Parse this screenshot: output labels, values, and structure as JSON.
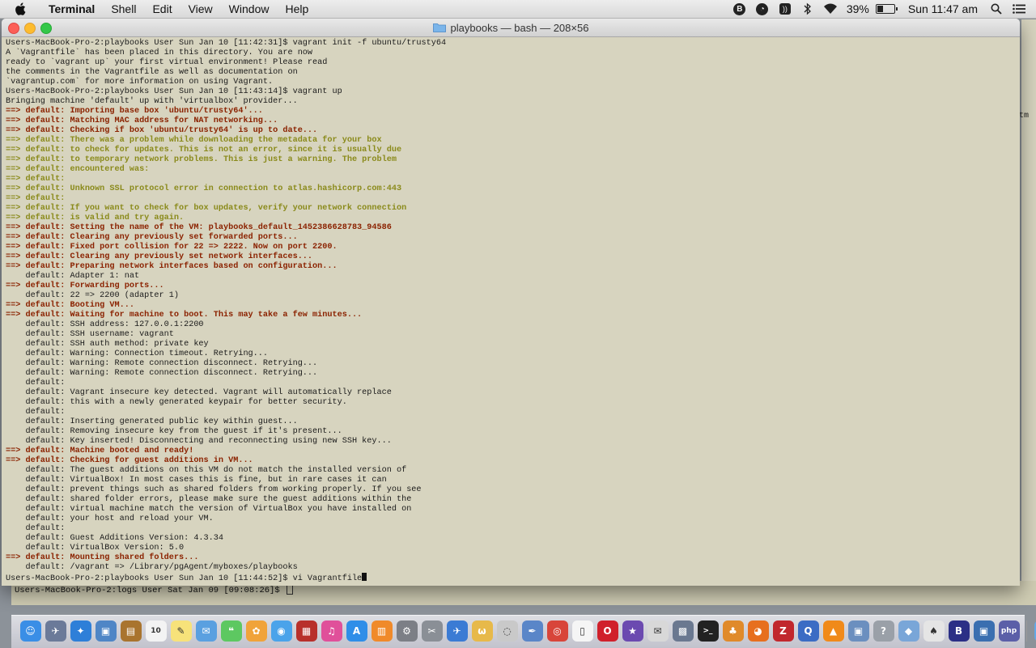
{
  "menubar": {
    "app_name": "Terminal",
    "menus": [
      "Shell",
      "Edit",
      "View",
      "Window",
      "Help"
    ],
    "battery": "39%",
    "clock": "Sun 11:47 am"
  },
  "window": {
    "title": "playbooks — bash — 208×56"
  },
  "terminal": {
    "lines": [
      {
        "text": "Users-MacBook-Pro-2:playbooks User Sun Jan 10 [11:42:31]$ vagrant init -f ubuntu/trusty64",
        "style": "plain"
      },
      {
        "text": "A `Vagrantfile` has been placed in this directory. You are now",
        "style": "plain"
      },
      {
        "text": "ready to `vagrant up` your first virtual environment! Please read",
        "style": "plain"
      },
      {
        "text": "the comments in the Vagrantfile as well as documentation on",
        "style": "plain"
      },
      {
        "text": "`vagrantup.com` for more information on using Vagrant.",
        "style": "plain"
      },
      {
        "text": "Users-MacBook-Pro-2:playbooks User Sun Jan 10 [11:43:14]$ vagrant up",
        "style": "plain"
      },
      {
        "text": "Bringing machine 'default' up with 'virtualbox' provider...",
        "style": "plain"
      },
      {
        "text": "==> default: Importing base box 'ubuntu/trusty64'...",
        "style": "warn"
      },
      {
        "text": "==> default: Matching MAC address for NAT networking...",
        "style": "warn"
      },
      {
        "text": "==> default: Checking if box 'ubuntu/trusty64' is up to date...",
        "style": "warn"
      },
      {
        "text": "==> default: There was a problem while downloading the metadata for your box",
        "style": "note"
      },
      {
        "text": "==> default: to check for updates. This is not an error, since it is usually due",
        "style": "note"
      },
      {
        "text": "==> default: to temporary network problems. This is just a warning. The problem",
        "style": "note"
      },
      {
        "text": "==> default: encountered was:",
        "style": "note"
      },
      {
        "text": "==> default:",
        "style": "note"
      },
      {
        "text": "==> default: Unknown SSL protocol error in connection to atlas.hashicorp.com:443",
        "style": "note"
      },
      {
        "text": "==> default:",
        "style": "note"
      },
      {
        "text": "==> default: If you want to check for box updates, verify your network connection",
        "style": "note"
      },
      {
        "text": "==> default: is valid and try again.",
        "style": "note"
      },
      {
        "text": "==> default: Setting the name of the VM: playbooks_default_1452386628783_94586",
        "style": "warn"
      },
      {
        "text": "==> default: Clearing any previously set forwarded ports...",
        "style": "warn"
      },
      {
        "text": "==> default: Fixed port collision for 22 => 2222. Now on port 2200.",
        "style": "warn"
      },
      {
        "text": "==> default: Clearing any previously set network interfaces...",
        "style": "warn"
      },
      {
        "text": "==> default: Preparing network interfaces based on configuration...",
        "style": "warn"
      },
      {
        "text": "    default: Adapter 1: nat",
        "style": "plain"
      },
      {
        "text": "==> default: Forwarding ports...",
        "style": "warn"
      },
      {
        "text": "    default: 22 => 2200 (adapter 1)",
        "style": "plain"
      },
      {
        "text": "==> default: Booting VM...",
        "style": "warn"
      },
      {
        "text": "==> default: Waiting for machine to boot. This may take a few minutes...",
        "style": "warn"
      },
      {
        "text": "    default: SSH address: 127.0.0.1:2200",
        "style": "plain"
      },
      {
        "text": "    default: SSH username: vagrant",
        "style": "plain"
      },
      {
        "text": "    default: SSH auth method: private key",
        "style": "plain"
      },
      {
        "text": "    default: Warning: Connection timeout. Retrying...",
        "style": "plain"
      },
      {
        "text": "    default: Warning: Remote connection disconnect. Retrying...",
        "style": "plain"
      },
      {
        "text": "    default: Warning: Remote connection disconnect. Retrying...",
        "style": "plain"
      },
      {
        "text": "    default:",
        "style": "plain"
      },
      {
        "text": "    default: Vagrant insecure key detected. Vagrant will automatically replace",
        "style": "plain"
      },
      {
        "text": "    default: this with a newly generated keypair for better security.",
        "style": "plain"
      },
      {
        "text": "    default:",
        "style": "plain"
      },
      {
        "text": "    default: Inserting generated public key within guest...",
        "style": "plain"
      },
      {
        "text": "    default: Removing insecure key from the guest if it's present...",
        "style": "plain"
      },
      {
        "text": "    default: Key inserted! Disconnecting and reconnecting using new SSH key...",
        "style": "plain"
      },
      {
        "text": "==> default: Machine booted and ready!",
        "style": "warn"
      },
      {
        "text": "==> default: Checking for guest additions in VM...",
        "style": "warn"
      },
      {
        "text": "    default: The guest additions on this VM do not match the installed version of",
        "style": "plain"
      },
      {
        "text": "    default: VirtualBox! In most cases this is fine, but in rare cases it can",
        "style": "plain"
      },
      {
        "text": "    default: prevent things such as shared folders from working properly. If you see",
        "style": "plain"
      },
      {
        "text": "    default: shared folder errors, please make sure the guest additions within the",
        "style": "plain"
      },
      {
        "text": "    default: virtual machine match the version of VirtualBox you have installed on",
        "style": "plain"
      },
      {
        "text": "    default: your host and reload your VM.",
        "style": "plain"
      },
      {
        "text": "    default:",
        "style": "plain"
      },
      {
        "text": "    default: Guest Additions Version: 4.3.34",
        "style": "plain"
      },
      {
        "text": "    default: VirtualBox Version: 5.0",
        "style": "plain"
      },
      {
        "text": "==> default: Mounting shared folders...",
        "style": "warn"
      },
      {
        "text": "    default: /vagrant => /Library/pgAgent/myboxes/playbooks",
        "style": "plain"
      },
      {
        "text": "Users-MacBook-Pro-2:playbooks User Sun Jan 10 [11:44:52]$ vi Vagrantfile",
        "style": "plain"
      }
    ]
  },
  "background_terminal": {
    "prompt": "Users-MacBook-Pro-2:logs User Sat Jan 09 [09:08:26]$ ",
    "right_edge_text": "tm"
  },
  "dock": {
    "apps": [
      {
        "name": "finder-icon",
        "color": "#3a8ee6",
        "glyph": "☺"
      },
      {
        "name": "launchpad-icon",
        "color": "#6b7a99",
        "glyph": "✈"
      },
      {
        "name": "safari-icon",
        "color": "#2e7fd8",
        "glyph": "✦"
      },
      {
        "name": "preview-icon",
        "color": "#4f86c6",
        "glyph": "▣"
      },
      {
        "name": "notebook-icon",
        "color": "#a9742e",
        "glyph": "▤"
      },
      {
        "name": "calendar-icon",
        "color": "#f3f3f3",
        "glyph": "10"
      },
      {
        "name": "notes-icon",
        "color": "#f7e27a",
        "glyph": "✎"
      },
      {
        "name": "mail-icon",
        "color": "#5aa0e0",
        "glyph": "✉"
      },
      {
        "name": "messages-icon",
        "color": "#5dc861",
        "glyph": "❝"
      },
      {
        "name": "photos-icon",
        "color": "#f0a33a",
        "glyph": "✿"
      },
      {
        "name": "facetime-icon",
        "color": "#4aa3ea",
        "glyph": "◉"
      },
      {
        "name": "photo-booth-icon",
        "color": "#b8302b",
        "glyph": "▦"
      },
      {
        "name": "itunes-icon",
        "color": "#e0509a",
        "glyph": "♫"
      },
      {
        "name": "app-store-icon",
        "color": "#2f8ee8",
        "glyph": "A"
      },
      {
        "name": "ibooks-icon",
        "color": "#f08a2a",
        "glyph": "▥"
      },
      {
        "name": "system-preferences-icon",
        "color": "#7c7f86",
        "glyph": "⚙"
      },
      {
        "name": "grab-icon",
        "color": "#8a8f96",
        "glyph": "✂"
      },
      {
        "name": "xcode-icon",
        "color": "#3b7bd4",
        "glyph": "✈"
      },
      {
        "name": "filezilla-icon",
        "color": "#e7b94a",
        "glyph": "ω"
      },
      {
        "name": "disk-utility-icon",
        "color": "#c9c9c9",
        "glyph": "◌"
      },
      {
        "name": "paint-icon",
        "color": "#5a86c8",
        "glyph": "✒"
      },
      {
        "name": "chrome-icon",
        "color": "#d8453a",
        "glyph": "◎"
      },
      {
        "name": "text-file-icon",
        "color": "#f5f5f5",
        "glyph": "▯"
      },
      {
        "name": "opera-icon",
        "color": "#d0202b",
        "glyph": "O"
      },
      {
        "name": "imovie-icon",
        "color": "#6b4ab0",
        "glyph": "★"
      },
      {
        "name": "script-editor-icon",
        "color": "#d8d8d8",
        "glyph": "✉"
      },
      {
        "name": "image-capture-icon",
        "color": "#6a7890",
        "glyph": "▩"
      },
      {
        "name": "terminal-icon",
        "color": "#222222",
        "glyph": ">_"
      },
      {
        "name": "gimp-icon",
        "color": "#e08a2a",
        "glyph": "♣"
      },
      {
        "name": "firefox-icon",
        "color": "#e76f1e",
        "glyph": "◕"
      },
      {
        "name": "filezilla-alt-icon",
        "color": "#c1272d",
        "glyph": "Z"
      },
      {
        "name": "quicktime-icon",
        "color": "#3b6cc4",
        "glyph": "Q"
      },
      {
        "name": "vlc-icon",
        "color": "#f08a1a",
        "glyph": "▲"
      },
      {
        "name": "network-icon",
        "color": "#6b8fbf",
        "glyph": "▣"
      },
      {
        "name": "help-icon",
        "color": "#9aa0a8",
        "glyph": "?"
      },
      {
        "name": "box-icon",
        "color": "#79a6d8",
        "glyph": "◆"
      },
      {
        "name": "cards-icon",
        "color": "#e5e5e5",
        "glyph": "♠"
      },
      {
        "name": "bbedit-icon",
        "color": "#2b2f86",
        "glyph": "B"
      },
      {
        "name": "virtualbox-icon",
        "color": "#3a6fb0",
        "glyph": "▣"
      },
      {
        "name": "php-icon",
        "color": "#5b5fa8",
        "glyph": "php"
      }
    ],
    "trailing": [
      {
        "name": "folder-icon",
        "color": "#63a8e6",
        "glyph": "▭"
      },
      {
        "name": "trash-icon",
        "color": "#c9ccd1",
        "glyph": "🗑"
      }
    ]
  }
}
